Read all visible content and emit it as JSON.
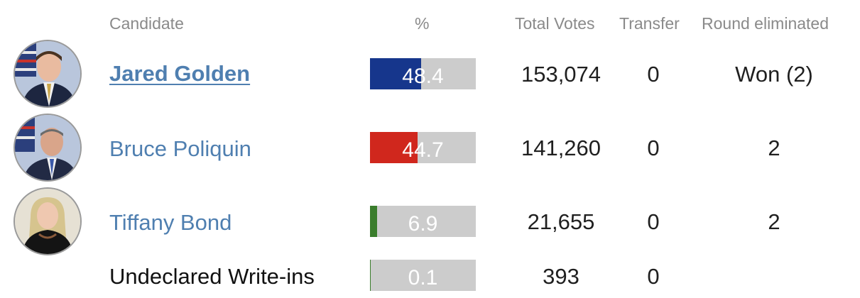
{
  "headers": {
    "candidate": "Candidate",
    "percent": "%",
    "total_votes": "Total Votes",
    "transfer": "Transfer",
    "round_eliminated": "Round eliminated"
  },
  "candidates": [
    {
      "name": "Jared Golden",
      "percent": 48.4,
      "percent_label": "48.4",
      "bar_color": "#16368c",
      "total_votes": "153,074",
      "transfer": "0",
      "round_eliminated": "Won (2)",
      "winner": true,
      "has_photo": true,
      "photo": "candidate-photo-jared-golden"
    },
    {
      "name": "Bruce Poliquin",
      "percent": 44.7,
      "percent_label": "44.7",
      "bar_color": "#d0271d",
      "total_votes": "141,260",
      "transfer": "0",
      "round_eliminated": "2",
      "winner": false,
      "has_photo": true,
      "photo": "candidate-photo-bruce-poliquin"
    },
    {
      "name": "Tiffany Bond",
      "percent": 6.9,
      "percent_label": "6.9",
      "bar_color": "#3a7d2c",
      "total_votes": "21,655",
      "transfer": "0",
      "round_eliminated": "2",
      "winner": false,
      "has_photo": true,
      "photo": "candidate-photo-tiffany-bond"
    },
    {
      "name": "Undeclared Write-ins",
      "percent": 0.1,
      "percent_label": "0.1",
      "bar_color": "#3a7d2c",
      "total_votes": "393",
      "transfer": "0",
      "round_eliminated": "",
      "winner": false,
      "has_photo": false,
      "photo": ""
    }
  ],
  "colors": {
    "header_text": "#8a8a8a",
    "link": "#4f7fb0",
    "bar_background": "#cccccc",
    "bar_label": "#ffffff"
  }
}
